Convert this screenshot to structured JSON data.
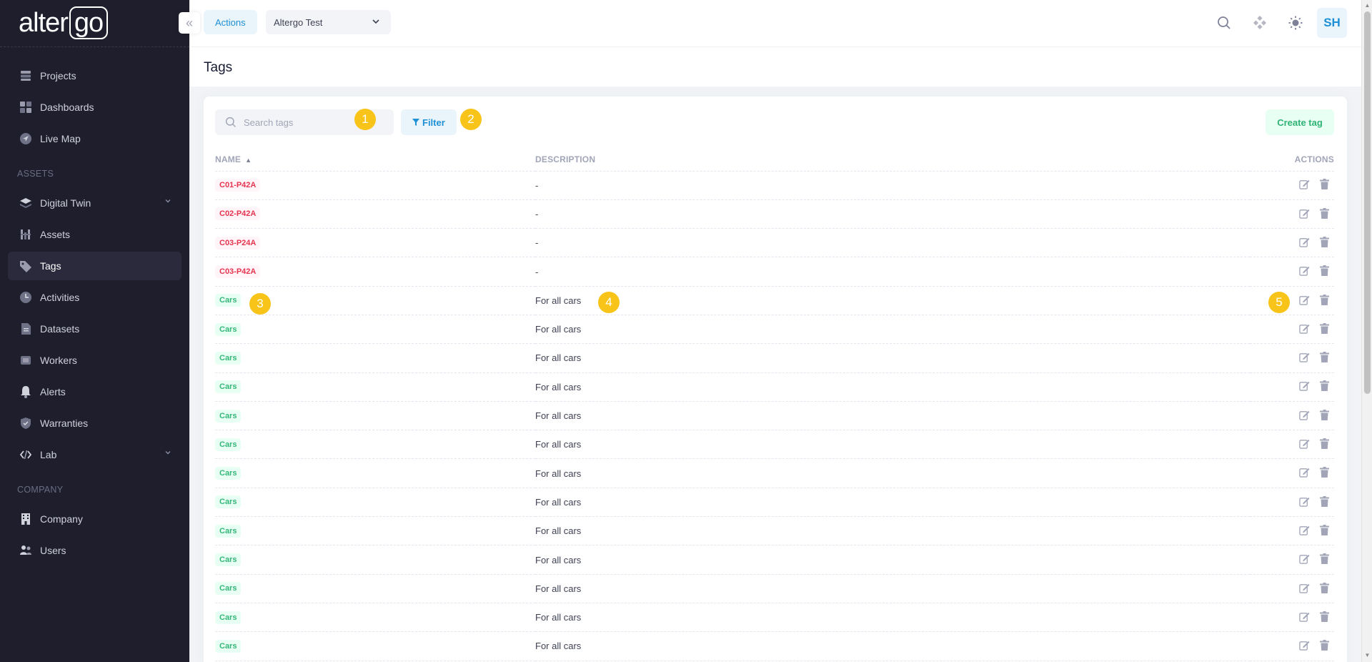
{
  "app": {
    "logo_text_a": "alter",
    "logo_text_b": "go"
  },
  "sidebar": {
    "items_top": [
      {
        "label": "Projects",
        "icon": "projects-icon"
      },
      {
        "label": "Dashboards",
        "icon": "dashboards-icon"
      },
      {
        "label": "Live Map",
        "icon": "live-map-icon"
      }
    ],
    "section_assets": "ASSETS",
    "items_assets": [
      {
        "label": "Digital Twin",
        "icon": "digital-twin-icon",
        "expandable": true
      },
      {
        "label": "Assets",
        "icon": "assets-icon"
      },
      {
        "label": "Tags",
        "icon": "tags-icon",
        "active": true
      },
      {
        "label": "Activities",
        "icon": "activities-icon"
      },
      {
        "label": "Datasets",
        "icon": "datasets-icon"
      },
      {
        "label": "Workers",
        "icon": "workers-icon"
      },
      {
        "label": "Alerts",
        "icon": "alerts-icon"
      },
      {
        "label": "Warranties",
        "icon": "warranties-icon"
      },
      {
        "label": "Lab",
        "icon": "lab-icon",
        "expandable": true
      }
    ],
    "section_company": "COMPANY",
    "items_company": [
      {
        "label": "Company",
        "icon": "company-icon"
      },
      {
        "label": "Users",
        "icon": "users-icon"
      }
    ]
  },
  "header": {
    "actions_label": "Actions",
    "project_select_value": "Altergo Test",
    "avatar_initials": "SH"
  },
  "page": {
    "title": "Tags"
  },
  "toolbar": {
    "search_placeholder": "Search tags",
    "filter_label": "Filter",
    "create_label": "Create tag"
  },
  "table": {
    "columns": {
      "name": "NAME",
      "description": "DESCRIPTION",
      "actions": "ACTIONS"
    },
    "rows": [
      {
        "name": "C01-P42A",
        "color": "red",
        "description": "-"
      },
      {
        "name": "C02-P42A",
        "color": "red",
        "description": "-"
      },
      {
        "name": "C03-P24A",
        "color": "red",
        "description": "-"
      },
      {
        "name": "C03-P42A",
        "color": "red",
        "description": "-"
      },
      {
        "name": "Cars",
        "color": "green",
        "description": "For all cars"
      },
      {
        "name": "Cars",
        "color": "green",
        "description": "For all cars"
      },
      {
        "name": "Cars",
        "color": "green",
        "description": "For all cars"
      },
      {
        "name": "Cars",
        "color": "green",
        "description": "For all cars"
      },
      {
        "name": "Cars",
        "color": "green",
        "description": "For all cars"
      },
      {
        "name": "Cars",
        "color": "green",
        "description": "For all cars"
      },
      {
        "name": "Cars",
        "color": "green",
        "description": "For all cars"
      },
      {
        "name": "Cars",
        "color": "green",
        "description": "For all cars"
      },
      {
        "name": "Cars",
        "color": "green",
        "description": "For all cars"
      },
      {
        "name": "Cars",
        "color": "green",
        "description": "For all cars"
      },
      {
        "name": "Cars",
        "color": "green",
        "description": "For all cars"
      },
      {
        "name": "Cars",
        "color": "green",
        "description": "For all cars"
      },
      {
        "name": "Cars",
        "color": "green",
        "description": "For all cars"
      }
    ]
  },
  "annotations": [
    "1",
    "2",
    "3",
    "4",
    "5"
  ],
  "colors": {
    "sidebar_bg": "#1e1e2d",
    "accent_blue": "#1e90d6",
    "tag_red": "#e6334f",
    "tag_green": "#35b77a",
    "badge_yellow": "#f8c41a"
  }
}
